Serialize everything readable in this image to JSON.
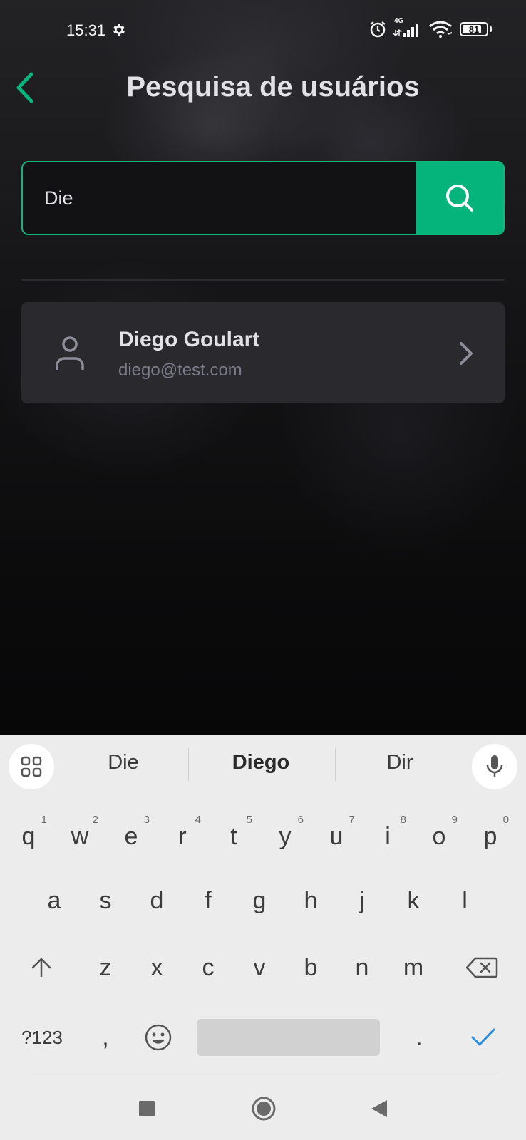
{
  "status": {
    "time": "15:31",
    "network": "4G",
    "battery": "81",
    "battery_level": 0.81
  },
  "header": {
    "title": "Pesquisa de usuários",
    "back_icon": "chevron-left-icon"
  },
  "search": {
    "value": "Die",
    "placeholder": "",
    "button_icon": "search-icon"
  },
  "results": [
    {
      "name": "Diego Goulart",
      "email": "diego@test.com"
    }
  ],
  "keyboard": {
    "suggestions": [
      "Die",
      "Diego",
      "Dir"
    ],
    "row1": [
      {
        "k": "q",
        "h": "1"
      },
      {
        "k": "w",
        "h": "2"
      },
      {
        "k": "e",
        "h": "3"
      },
      {
        "k": "r",
        "h": "4"
      },
      {
        "k": "t",
        "h": "5"
      },
      {
        "k": "y",
        "h": "6"
      },
      {
        "k": "u",
        "h": "7"
      },
      {
        "k": "i",
        "h": "8"
      },
      {
        "k": "o",
        "h": "9"
      },
      {
        "k": "p",
        "h": "0"
      }
    ],
    "row2": [
      "a",
      "s",
      "d",
      "f",
      "g",
      "h",
      "j",
      "k",
      "l"
    ],
    "row3": [
      "z",
      "x",
      "c",
      "v",
      "b",
      "n",
      "m"
    ],
    "symbols_label": "?123",
    "comma": ",",
    "period": "."
  },
  "colors": {
    "accent": "#04b47a",
    "card": "#29292e",
    "text": "#e1e1e6",
    "muted": "#7c7c8a"
  }
}
